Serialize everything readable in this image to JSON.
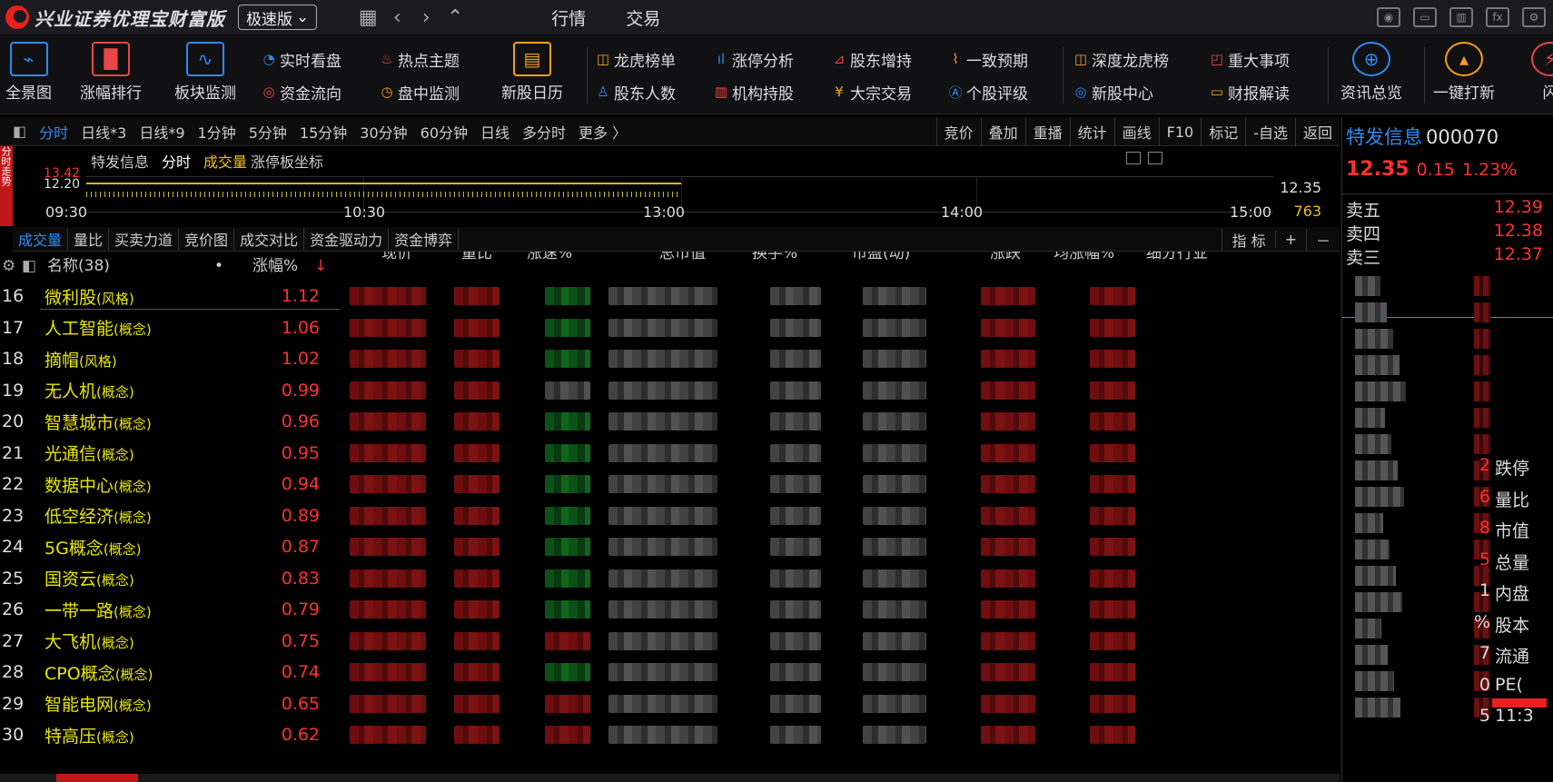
{
  "app": {
    "title": "兴业证券优理宝财富版",
    "edition": "极速版"
  },
  "menu": {
    "market": "行情",
    "trade": "交易"
  },
  "toolbar": {
    "big": [
      {
        "label": "全景图",
        "icon": "panorama-icon"
      },
      {
        "label": "涨幅排行",
        "icon": "ranking-icon"
      },
      {
        "label": "板块监测",
        "icon": "sector-monitor-icon"
      },
      {
        "label": "新股日历",
        "icon": "ipo-calendar-icon"
      },
      {
        "label": "资讯总览",
        "icon": "globe-icon"
      },
      {
        "label": "一键打新",
        "icon": "one-click-ipo-icon"
      },
      {
        "label": "闪",
        "icon": "flash-icon"
      }
    ],
    "small": [
      {
        "label": "实时看盘",
        "icon": "realtime-icon"
      },
      {
        "label": "热点主题",
        "icon": "flame-icon"
      },
      {
        "label": "资金流向",
        "icon": "flow-icon"
      },
      {
        "label": "盘中监测",
        "icon": "monitor-icon"
      },
      {
        "label": "龙虎榜单",
        "icon": "dragon-tiger-icon"
      },
      {
        "label": "涨停分析",
        "icon": "limit-up-icon"
      },
      {
        "label": "股东增持",
        "icon": "shareholder-increase-icon"
      },
      {
        "label": "一致预期",
        "icon": "consensus-icon"
      },
      {
        "label": "股东人数",
        "icon": "shareholder-count-icon"
      },
      {
        "label": "机构持股",
        "icon": "institution-icon"
      },
      {
        "label": "大宗交易",
        "icon": "block-trade-icon"
      },
      {
        "label": "个股评级",
        "icon": "rating-icon"
      },
      {
        "label": "深度龙虎榜",
        "icon": "deep-dragon-tiger-icon"
      },
      {
        "label": "重大事项",
        "icon": "major-event-icon"
      },
      {
        "label": "新股中心",
        "icon": "ipo-center-icon"
      },
      {
        "label": "财报解读",
        "icon": "report-icon"
      }
    ]
  },
  "period_tabs": [
    "分时",
    "日线*3",
    "日线*9",
    "1分钟",
    "5分钟",
    "15分钟",
    "30分钟",
    "60分钟",
    "日线",
    "多分时",
    "更多 〉"
  ],
  "chart_tools": [
    "竞价",
    "叠加",
    "重播",
    "统计",
    "画线",
    "F10",
    "标记",
    "-自选",
    "返回"
  ],
  "chart": {
    "title": "特发信息",
    "mode": "分时",
    "vol_label": "成交量",
    "coord_label": "涨停板坐标",
    "y_top": "13.42",
    "y_mid": "12.20",
    "times": [
      "09:30",
      "10:30",
      "13:00",
      "14:00",
      "15:00"
    ],
    "last_price": "12.35",
    "last_volume": "763",
    "side_tab": "分时走势"
  },
  "indicator_tabs": [
    "成交量",
    "量比",
    "买卖力道",
    "竞价图",
    "成交对比",
    "资金驱动力",
    "资金博弈"
  ],
  "indicator_right": {
    "label": "指 标",
    "plus": "+",
    "minus": "－"
  },
  "table": {
    "headers": {
      "name": "名称(38)",
      "change": "涨幅%",
      "price": "现价",
      "volume_ratio": "量比",
      "speed": "涨速%",
      "mktcap": "总市值",
      "turnover": "换手%",
      "pe": "市盈(动)",
      "chg": "涨跌",
      "avg": "均涨幅%",
      "industry": "细分行业"
    },
    "rows": [
      {
        "n": "16",
        "name": "微利股",
        "tag": "(风格)",
        "pct": "1.12"
      },
      {
        "n": "17",
        "name": "人工智能",
        "tag": "(概念)",
        "pct": "1.06"
      },
      {
        "n": "18",
        "name": "摘帽",
        "tag": "(风格)",
        "pct": "1.02"
      },
      {
        "n": "19",
        "name": "无人机",
        "tag": "(概念)",
        "pct": "0.99"
      },
      {
        "n": "20",
        "name": "智慧城市",
        "tag": "(概念)",
        "pct": "0.96"
      },
      {
        "n": "21",
        "name": "光通信",
        "tag": "(概念)",
        "pct": "0.95"
      },
      {
        "n": "22",
        "name": "数据中心",
        "tag": "(概念)",
        "pct": "0.94"
      },
      {
        "n": "23",
        "name": "低空经济",
        "tag": "(概念)",
        "pct": "0.89"
      },
      {
        "n": "24",
        "name": "5G概念",
        "tag": "(概念)",
        "pct": "0.87"
      },
      {
        "n": "25",
        "name": "国资云",
        "tag": "(概念)",
        "pct": "0.83"
      },
      {
        "n": "26",
        "name": "一带一路",
        "tag": "(概念)",
        "pct": "0.79"
      },
      {
        "n": "27",
        "name": "大飞机",
        "tag": "(概念)",
        "pct": "0.75"
      },
      {
        "n": "28",
        "name": "CPO概念",
        "tag": "(概念)",
        "pct": "0.74"
      },
      {
        "n": "29",
        "name": "智能电网",
        "tag": "(概念)",
        "pct": "0.65"
      },
      {
        "n": "30",
        "name": "特高压",
        "tag": "(概念)",
        "pct": "0.62"
      }
    ]
  },
  "stock": {
    "name": "特发信息",
    "code": "000070",
    "price": "12.35",
    "change": "0.15",
    "change_pct": "1.23%",
    "asks": [
      {
        "label": "卖五",
        "price": "12.39"
      },
      {
        "label": "卖四",
        "price": "12.38"
      },
      {
        "label": "卖三",
        "price": "12.37"
      }
    ],
    "side_labels": [
      "跌停",
      "量比",
      "市值",
      "总量",
      "内盘",
      "股本",
      "流通",
      "PE(",
      "11:3"
    ],
    "side_prefix": [
      "2",
      "6",
      "8",
      "5",
      "1",
      "%",
      "7",
      "0",
      "5"
    ]
  }
}
